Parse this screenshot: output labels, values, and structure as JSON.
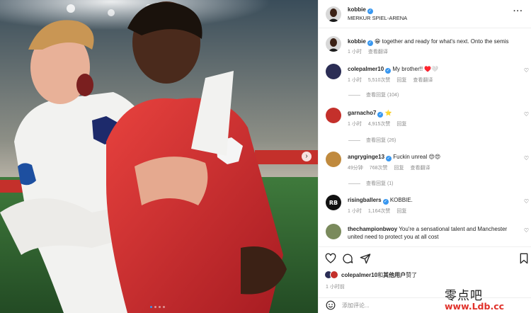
{
  "post": {
    "author": "kobbie",
    "location": "MERKUR SPIEL-ARENA",
    "more_icon": "more-horizontal-icon",
    "caption_emoji": "😁",
    "caption_text": "together and ready for what's next. Onto the semis",
    "caption_time": "1 小时",
    "see_translation": "查看翻译"
  },
  "comments": [
    {
      "user": "colepalmer10",
      "verified": true,
      "text": "My brother!! ♥️🤍",
      "time": "1 小时",
      "likes": "5,510次赞",
      "reply": "回复",
      "translate": "查看翻译",
      "view_replies": "查看回复 (104)",
      "avatar_color": "#2b2d55"
    },
    {
      "user": "garnacho7",
      "verified": true,
      "text": "⭐",
      "time": "1 小时",
      "likes": "4,915次赞",
      "reply": "回复",
      "translate": "",
      "view_replies": "查看回复 (26)",
      "avatar_color": "#c4302b"
    },
    {
      "user": "angryginge13",
      "verified": true,
      "text": "Fuckin unreal 😍😍",
      "time": "49分钟",
      "likes": "768次赞",
      "reply": "回复",
      "translate": "查看翻译",
      "view_replies": "查看回复 (1)",
      "avatar_color": "#c08a3e"
    },
    {
      "user": "risingballers",
      "verified": true,
      "text": "KOBBIE.",
      "time": "1 小时",
      "likes": "1,164次赞",
      "reply": "回复",
      "translate": "",
      "view_replies": "",
      "avatar_color": "#111111"
    },
    {
      "user": "thechampionbwoy",
      "verified": false,
      "text": "You're a sensational talent and Manchester united need to protect you at all cost",
      "time": "",
      "likes": "",
      "reply": "",
      "translate": "",
      "view_replies": "",
      "avatar_color": "#7a8a5c"
    }
  ],
  "actions": {
    "like_icon": "heart-icon",
    "comment_icon": "comment-icon",
    "share_icon": "send-icon",
    "save_icon": "bookmark-icon",
    "liked_by_user": "colepalmer10",
    "liked_by_join": "和",
    "liked_by_others": "其他用户",
    "liked_by_suffix": "赞了",
    "timestamp": "1 小时前"
  },
  "add_comment": {
    "placeholder": "添加评论..."
  },
  "watermark": {
    "chinese": "零点吧",
    "url": "www.Ldb.cc"
  },
  "carousel": {
    "total": 4,
    "active_index": 0
  },
  "colors": {
    "verified_blue": "#3897f0",
    "secondary_text": "#8e8e8e",
    "kit_red": "#d62a2f"
  }
}
